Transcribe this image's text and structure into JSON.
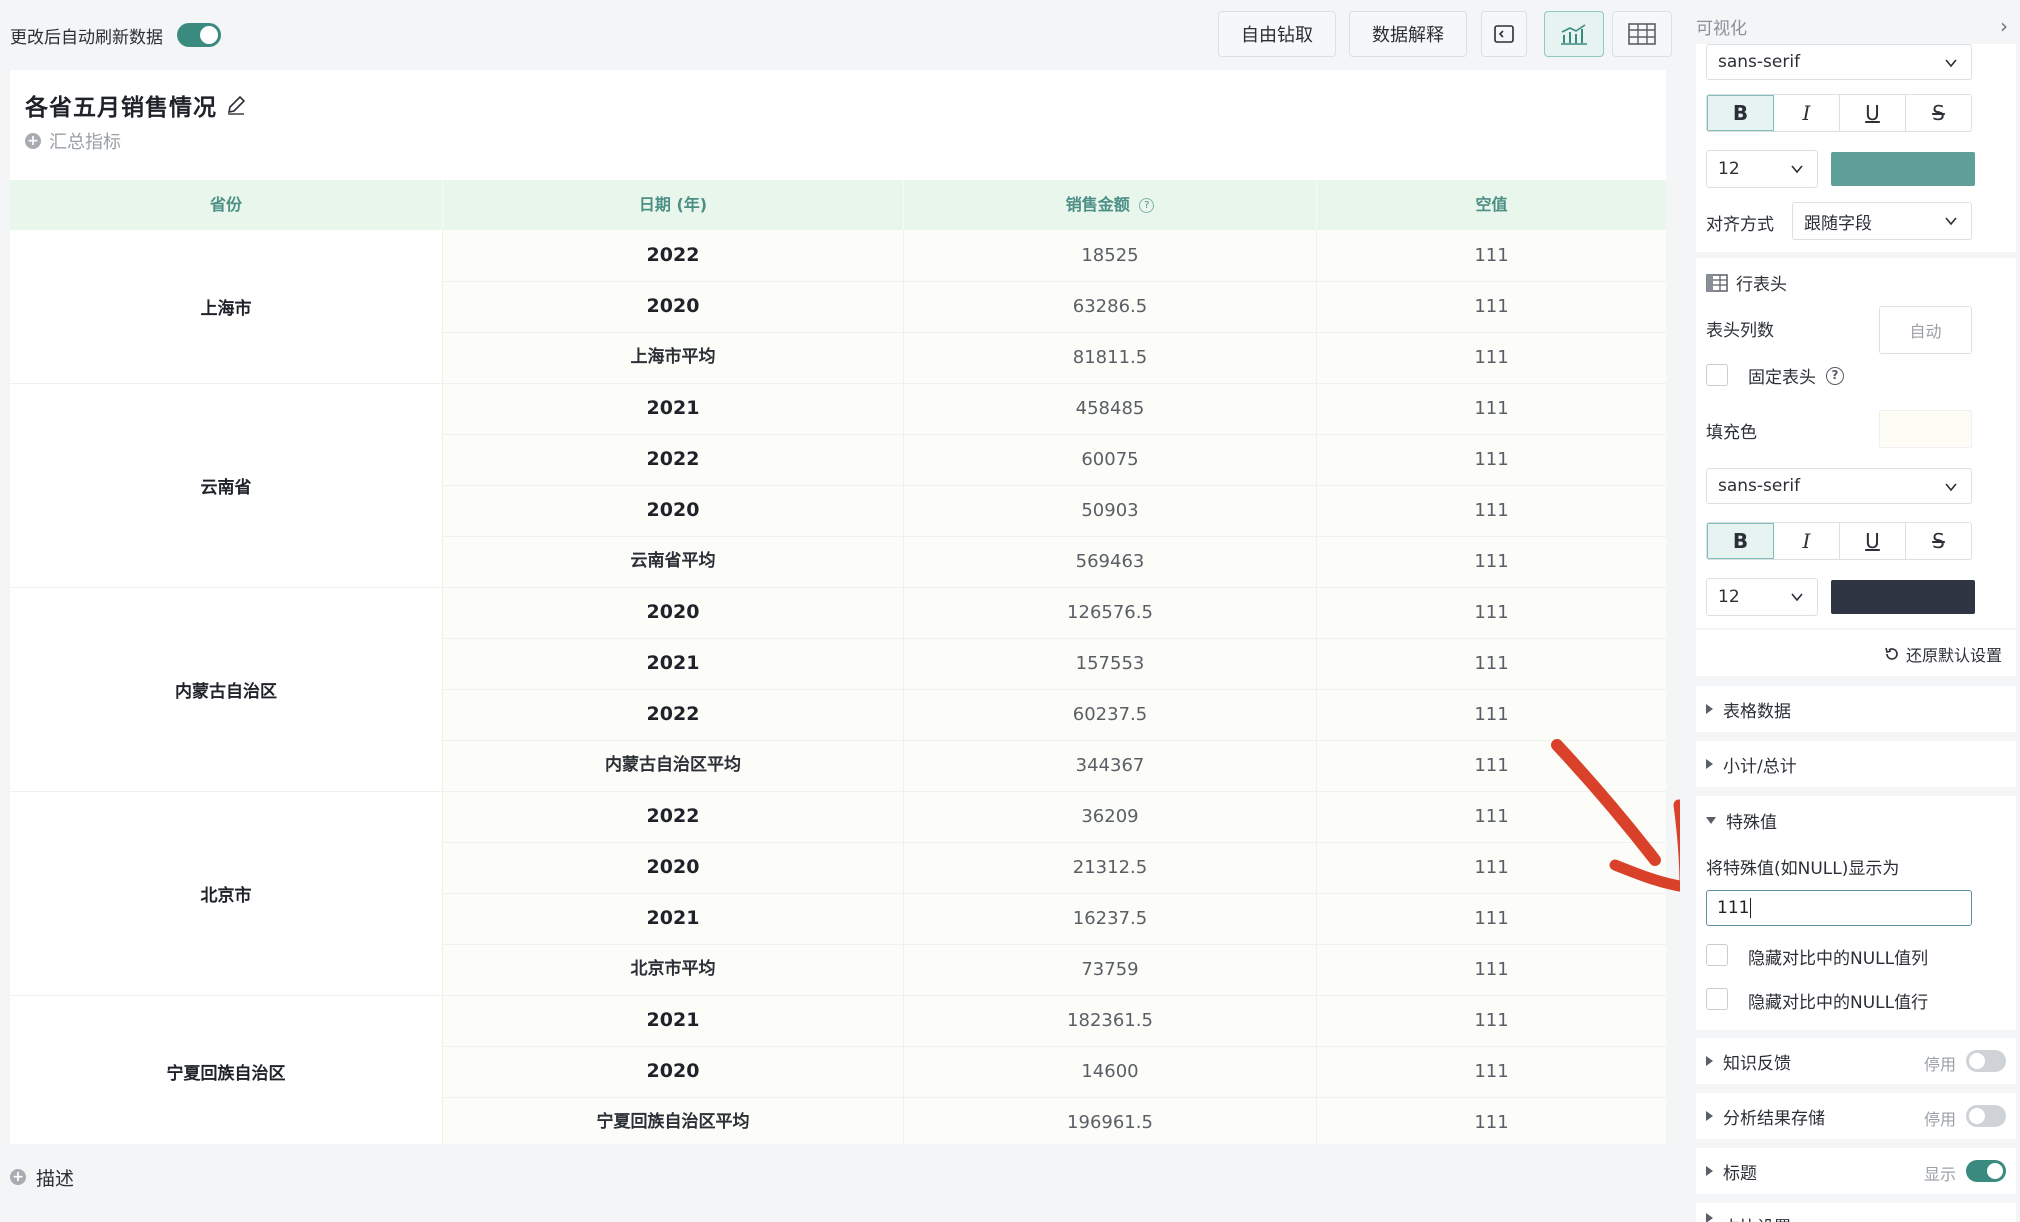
{
  "toolbar": {
    "auto_refresh_label": "更改后自动刷新数据",
    "auto_refresh_on": true,
    "drill_label": "自由钻取",
    "explain_label": "数据解释"
  },
  "report": {
    "title": "各省五月销售情况",
    "summary_label": "汇总指标",
    "description_label": "描述"
  },
  "table": {
    "headers": [
      "省份",
      "日期 (年)",
      "销售金额",
      "空值"
    ],
    "groups": [
      {
        "province": "上海市",
        "rows": [
          {
            "date": "2022",
            "amount": "18525",
            "null_value": "111",
            "type": "year"
          },
          {
            "date": "2020",
            "amount": "63286.5",
            "null_value": "111",
            "type": "year"
          },
          {
            "date": "上海市平均",
            "amount": "81811.5",
            "null_value": "111",
            "type": "avg"
          }
        ]
      },
      {
        "province": "云南省",
        "rows": [
          {
            "date": "2021",
            "amount": "458485",
            "null_value": "111",
            "type": "year"
          },
          {
            "date": "2022",
            "amount": "60075",
            "null_value": "111",
            "type": "year"
          },
          {
            "date": "2020",
            "amount": "50903",
            "null_value": "111",
            "type": "year"
          },
          {
            "date": "云南省平均",
            "amount": "569463",
            "null_value": "111",
            "type": "avg"
          }
        ]
      },
      {
        "province": "内蒙古自治区",
        "rows": [
          {
            "date": "2020",
            "amount": "126576.5",
            "null_value": "111",
            "type": "year"
          },
          {
            "date": "2021",
            "amount": "157553",
            "null_value": "111",
            "type": "year"
          },
          {
            "date": "2022",
            "amount": "60237.5",
            "null_value": "111",
            "type": "year"
          },
          {
            "date": "内蒙古自治区平均",
            "amount": "344367",
            "null_value": "111",
            "type": "avg"
          }
        ]
      },
      {
        "province": "北京市",
        "rows": [
          {
            "date": "2022",
            "amount": "36209",
            "null_value": "111",
            "type": "year"
          },
          {
            "date": "2020",
            "amount": "21312.5",
            "null_value": "111",
            "type": "year"
          },
          {
            "date": "2021",
            "amount": "16237.5",
            "null_value": "111",
            "type": "year"
          },
          {
            "date": "北京市平均",
            "amount": "73759",
            "null_value": "111",
            "type": "avg"
          }
        ]
      },
      {
        "province": "宁夏回族自治区",
        "rows": [
          {
            "date": "2021",
            "amount": "182361.5",
            "null_value": "111",
            "type": "year"
          },
          {
            "date": "2020",
            "amount": "14600",
            "null_value": "111",
            "type": "year"
          },
          {
            "date": "宁夏回族自治区平均",
            "amount": "196961.5",
            "null_value": "111",
            "type": "avg"
          }
        ]
      }
    ]
  },
  "panel": {
    "title": "可视化",
    "font_family_1": "sans-serif",
    "font_size_1": "12",
    "color_1": "#5e9f97",
    "align_label": "对齐方式",
    "align_value": "跟随字段",
    "row_header_label": "行表头",
    "header_cols_label": "表头列数",
    "header_cols_value": "自动",
    "fixed_header_label": "固定表头",
    "fill_color_label": "填充色",
    "fill_color": "#fdfdf6",
    "font_family_2": "sans-serif",
    "font_size_2": "12",
    "color_2": "#2f3542",
    "reset_label": "还原默认设置",
    "section_table_data": "表格数据",
    "section_subtotal": "小计/总计",
    "section_special": "特殊值",
    "special_display_label": "将特殊值(如NULL)显示为",
    "special_value": "111",
    "hide_null_cols": "隐藏对比中的NULL值列",
    "hide_null_rows": "隐藏对比中的NULL值行",
    "section_knowledge": "知识反馈",
    "knowledge_status": "停用",
    "section_storage": "分析结果存储",
    "storage_status": "停用",
    "section_title": "标题",
    "title_status": "显示",
    "section_more": "占比设置"
  },
  "style": {
    "accent": "#3a8a80",
    "header_bg": "#e9f6ec",
    "arrow": "#d9412b"
  }
}
